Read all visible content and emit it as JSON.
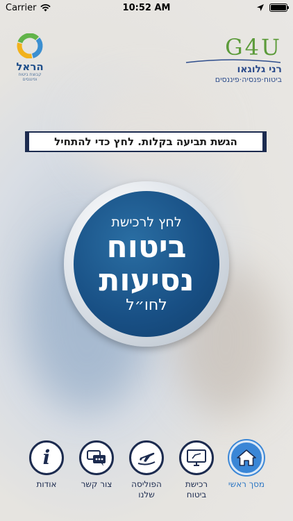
{
  "status_bar": {
    "carrier": "Carrier",
    "time": "10:52 AM"
  },
  "logos": {
    "harel_name": "הראל",
    "harel_sub": "קבוצת ביטוח ופיננסים",
    "g4u_mark": "G4U",
    "agent_name": "רני גלוגאו",
    "agent_tagline": "ביטוח·פנסיה·פיננסים"
  },
  "banner": {
    "text": "הגשת תביעה בקלות. לחץ כדי להתחיל"
  },
  "main_button": {
    "line1": "לחץ לרכישת",
    "line2": "ביטוח",
    "line3": "נסיעות",
    "line4": "לחו״ל"
  },
  "nav": {
    "items": [
      {
        "label": "מסך ראשי",
        "icon": "home-icon",
        "active": true
      },
      {
        "label": "רכישת ביטוח",
        "icon": "monitor-icon",
        "active": false
      },
      {
        "label": "הפוליסה שלנו",
        "icon": "plane-icon",
        "active": false
      },
      {
        "label": "צור קשר",
        "icon": "chat-icon",
        "active": false
      },
      {
        "label": "אודות",
        "icon": "info-icon",
        "active": false
      }
    ]
  },
  "colors": {
    "navy": "#1c2b4f",
    "circle_blue": "#184f84",
    "active_blue": "#3a86d6",
    "g4u_green": "#5c9b3a"
  }
}
